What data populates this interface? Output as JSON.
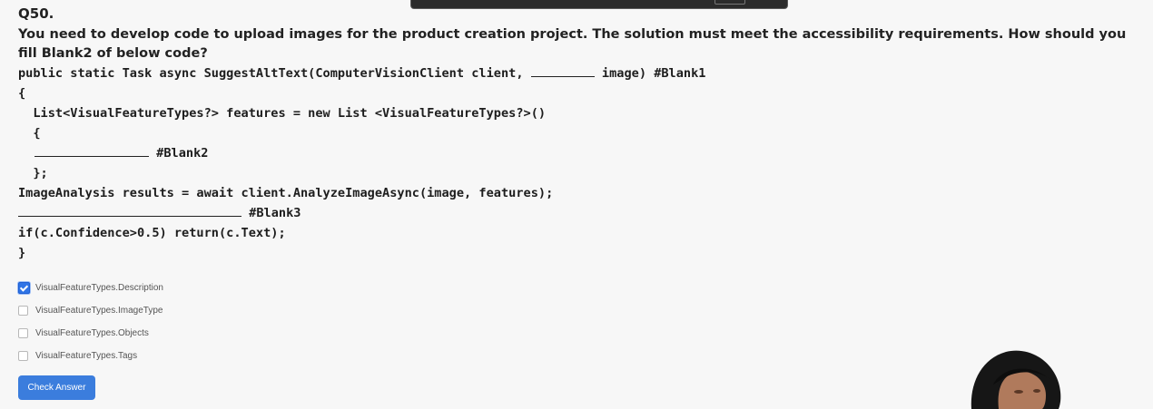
{
  "question": {
    "number": "Q50.",
    "text": "You need to develop code to upload images for the product creation project. The solution must meet the accessibility requirements. How should you fill Blank2 of below code?"
  },
  "code": {
    "line1_a": "public static Task async SuggestAltText(ComputerVisionClient client, ",
    "line1_b": " image) #Blank1",
    "line2": "{",
    "line3": "  List<VisualFeatureTypes?> features = new List <VisualFeatureTypes?>()",
    "line4": "  {",
    "line5_b": " #Blank2",
    "line6": "  };",
    "line7": "ImageAnalysis results = await client.AnalyzeImageAsync(image, features);",
    "line8_b": " #Blank3",
    "line9": "if(c.Confidence>0.5) return(c.Text);",
    "line10": "}"
  },
  "options": [
    {
      "label": "VisualFeatureTypes.Description",
      "checked": true
    },
    {
      "label": "VisualFeatureTypes.ImageType",
      "checked": false
    },
    {
      "label": "VisualFeatureTypes.Objects",
      "checked": false
    },
    {
      "label": "VisualFeatureTypes.Tags",
      "checked": false
    }
  ],
  "check_button": "Check Answer",
  "colors": {
    "accent": "#3b7ddd",
    "background": "#f7f7f7"
  }
}
